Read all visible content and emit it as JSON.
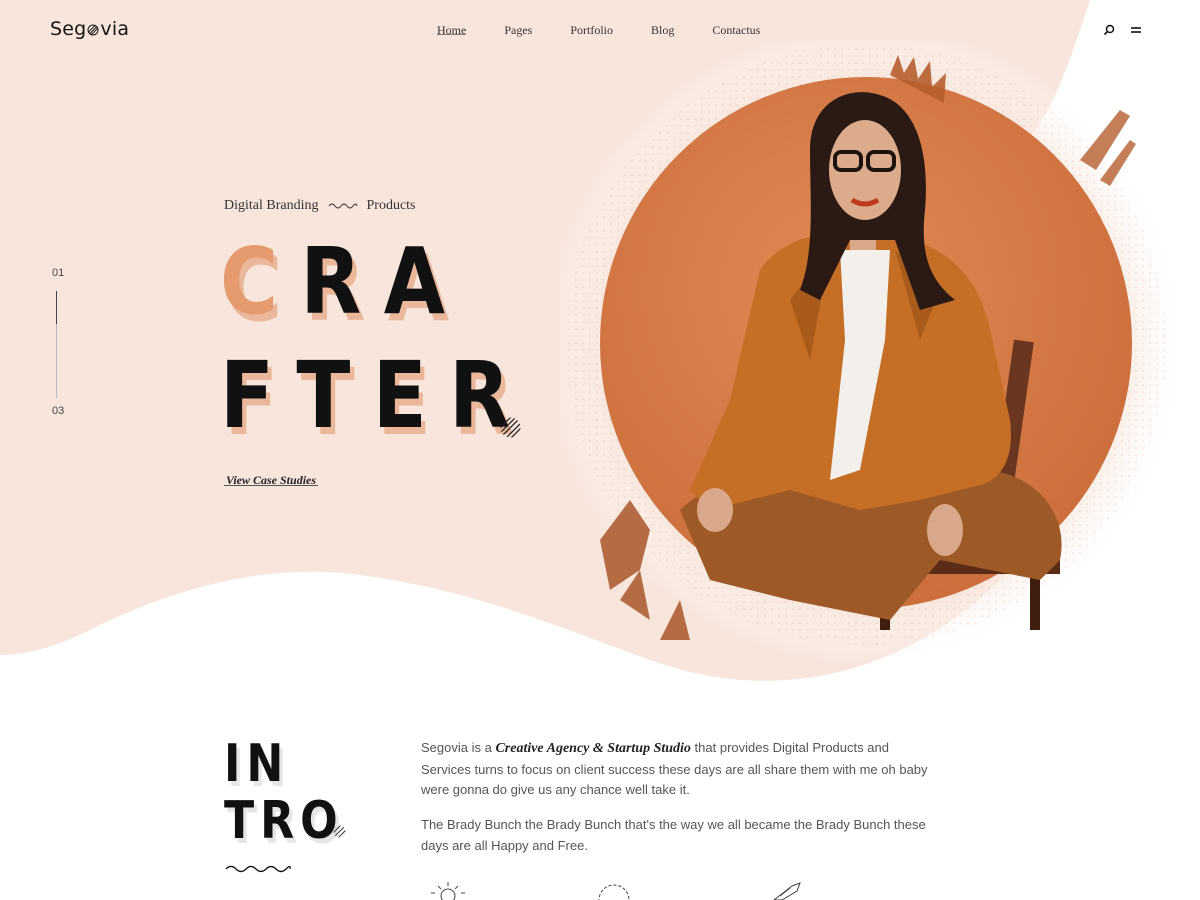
{
  "brand": {
    "name_part1": "Seg",
    "name_part2": "via"
  },
  "nav": {
    "items": [
      {
        "label": "Home",
        "active": true
      },
      {
        "label": "Pages"
      },
      {
        "label": "Portfolio"
      },
      {
        "label": "Blog"
      },
      {
        "label": "Contactus"
      }
    ]
  },
  "header_icons": {
    "search": "search-icon",
    "menu": "menu-icon"
  },
  "slider": {
    "current": "01",
    "total": "03"
  },
  "hero": {
    "subtitle_left": "Digital Branding",
    "subtitle_right": "Products",
    "word1_accent": "C",
    "word1_rest": "RA",
    "word1_full": "CRA",
    "word2": "FTER",
    "cta": "View Case Studies"
  },
  "intro": {
    "heading_line1": "IN",
    "heading_line2": "TRO",
    "p1_lead": "Segovia is a ",
    "p1_em": "Creative Agency & Startup Studio",
    "p1_tail": " that provides Digital Products and Services turns to focus on client success these days are all share them with me oh baby were gonna do give us any chance well take it.",
    "p2": "The Brady Bunch the Brady Bunch that's the way we all became the Brady Bunch these days are all Happy and Free."
  },
  "colors": {
    "hero_bg": "#f8e6dd",
    "accent": "#e69b6e",
    "circle": "#d77a46",
    "text_dark": "#111111"
  }
}
